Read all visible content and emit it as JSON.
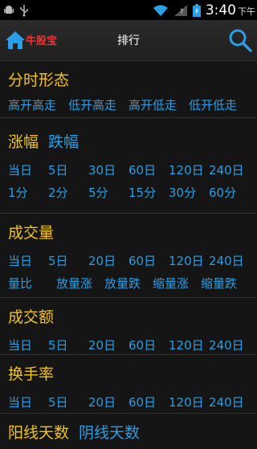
{
  "status": {
    "time": "3:40",
    "ampm": "下午"
  },
  "header": {
    "brand": "牛股宝",
    "title": "排行"
  },
  "sections": [
    {
      "title": "分时形态",
      "rows": [
        [
          "高开高走",
          "低开高走",
          "高开低走",
          "低开低走"
        ]
      ]
    },
    {
      "title": "涨幅",
      "alt_tab": "跌幅",
      "rows": [
        [
          "当日",
          "5日",
          "30日",
          "60日",
          "120日",
          "240日"
        ],
        [
          "1分",
          "2分",
          "5分",
          "15分",
          "30分",
          "60分"
        ]
      ]
    },
    {
      "title": "成交量",
      "rows": [
        [
          "当日",
          "5日",
          "20日",
          "60日",
          "120日",
          "240日"
        ],
        [
          "量比",
          "放量涨",
          "放量跌",
          "缩量涨",
          "缩量跌"
        ]
      ]
    },
    {
      "title": "成交额",
      "rows": [
        [
          "当日",
          "5日",
          "20日",
          "60日",
          "120日",
          "240日"
        ]
      ]
    },
    {
      "title": "换手率",
      "rows": [
        [
          "当日",
          "5日",
          "20日",
          "60日",
          "120日",
          "240日"
        ]
      ]
    },
    {
      "title": "阳线天数",
      "alt_tab": "阴线天数",
      "rows": []
    }
  ],
  "colors": {
    "heading": "#f2c318",
    "link": "#2a9ee6",
    "brand": "#e33"
  },
  "icons": {
    "home": "home-icon",
    "search": "search-icon"
  }
}
